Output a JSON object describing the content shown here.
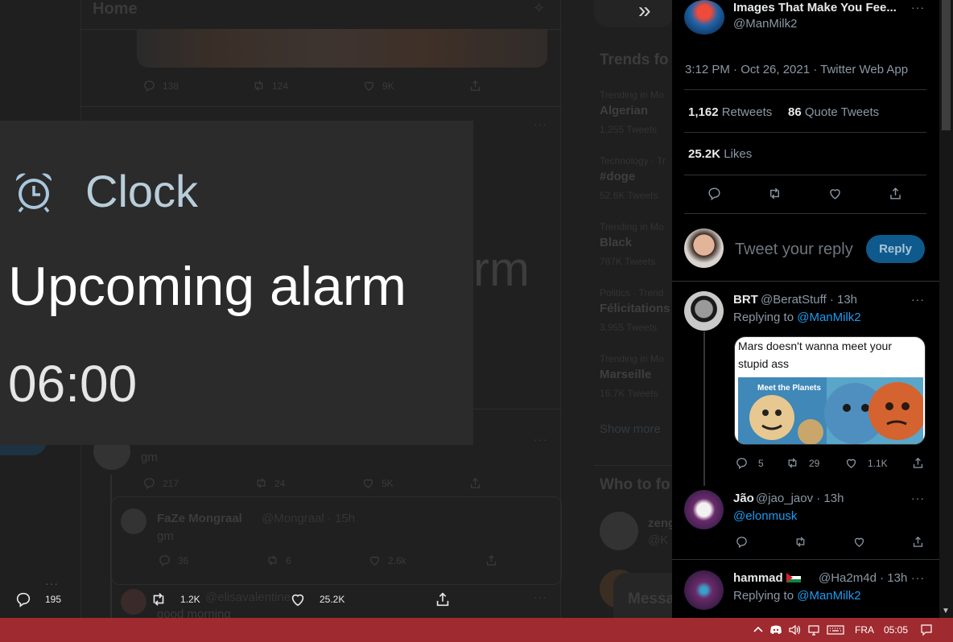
{
  "background": {
    "home_title": "Home",
    "top_actions": {
      "replies": "138",
      "retweets": "124",
      "likes": "9K"
    },
    "tweet2_text": "gm",
    "tweet2_actions": {
      "replies": "217",
      "retweets": "24",
      "likes": "5K"
    },
    "tweet3_name": "FaZe Mongraal",
    "tweet3_handle": "@Mongraal · 15h",
    "tweet3_text": "gm",
    "tweet3_actions": {
      "replies": "36",
      "retweets": "6",
      "likes": "2.6k"
    },
    "tweet4_handle": "@elisavalentine",
    "tweet4_text": "good morning",
    "bottom_actions": {
      "replies": "195",
      "retweets": "1.2K",
      "likes": "25.2K"
    },
    "trends_title": "Trends fo",
    "trends": [
      {
        "category": "Trending in Mo",
        "name": "Algerian",
        "count": "1,255 Tweets"
      },
      {
        "category": "Technology · Tr",
        "name": "#doge",
        "count": "52.6K Tweets"
      },
      {
        "category": "Trending in Mo",
        "name": "Black",
        "count": "787K Tweets"
      },
      {
        "category": "Politics · Trend",
        "name": "Félicitations",
        "count": "3,955 Tweets"
      },
      {
        "category": "Trending in Mo",
        "name": "Marseille",
        "count": "16.7K Tweets"
      }
    ],
    "show_more": "Show more",
    "who_to_follow": "Who to fo",
    "who_name": "zeng",
    "who_handle": "@K",
    "messages": "Messa",
    "ghost_text": "rm"
  },
  "alarm": {
    "app_name": "Clock",
    "title": "Upcoming alarm",
    "time": "06:00"
  },
  "tweet": {
    "author_name": "Images That Make You Fee...",
    "author_handle": "@ManMilk2",
    "meta": "3:12 PM · Oct 26, 2021 · Twitter Web App",
    "retweets_count": "1,162",
    "retweets_label": "Retweets",
    "quotes_count": "86",
    "quotes_label": "Quote Tweets",
    "likes_count": "25.2K",
    "likes_label": "Likes",
    "reply_placeholder": "Tweet your reply",
    "reply_button": "Reply"
  },
  "replies": [
    {
      "name": "BRT",
      "handle": "@BeratStuff · 13h",
      "replying_label": "Replying to",
      "replying_to": "@ManMilk2",
      "media_caption": "Mars doesn't wanna meet your stupid ass",
      "media_poster_text": "Meet the Planets",
      "replies": "5",
      "retweets": "29",
      "likes": "1.1K"
    },
    {
      "name": "Jão",
      "handle": "@jao_jaov · 13h",
      "text": "@elonmusk"
    },
    {
      "name": "hammad",
      "handle": "@Ha2m4d · 13h",
      "replying_label": "Replying to",
      "replying_to": "@ManMilk2"
    }
  ],
  "taskbar": {
    "language": "FRA",
    "time": "05:05"
  },
  "colors": {
    "taskbar": "#9f2a2f",
    "link": "#1d9bf0",
    "panel_bg": "#000000",
    "toast_bg": "#2b2b2b"
  }
}
